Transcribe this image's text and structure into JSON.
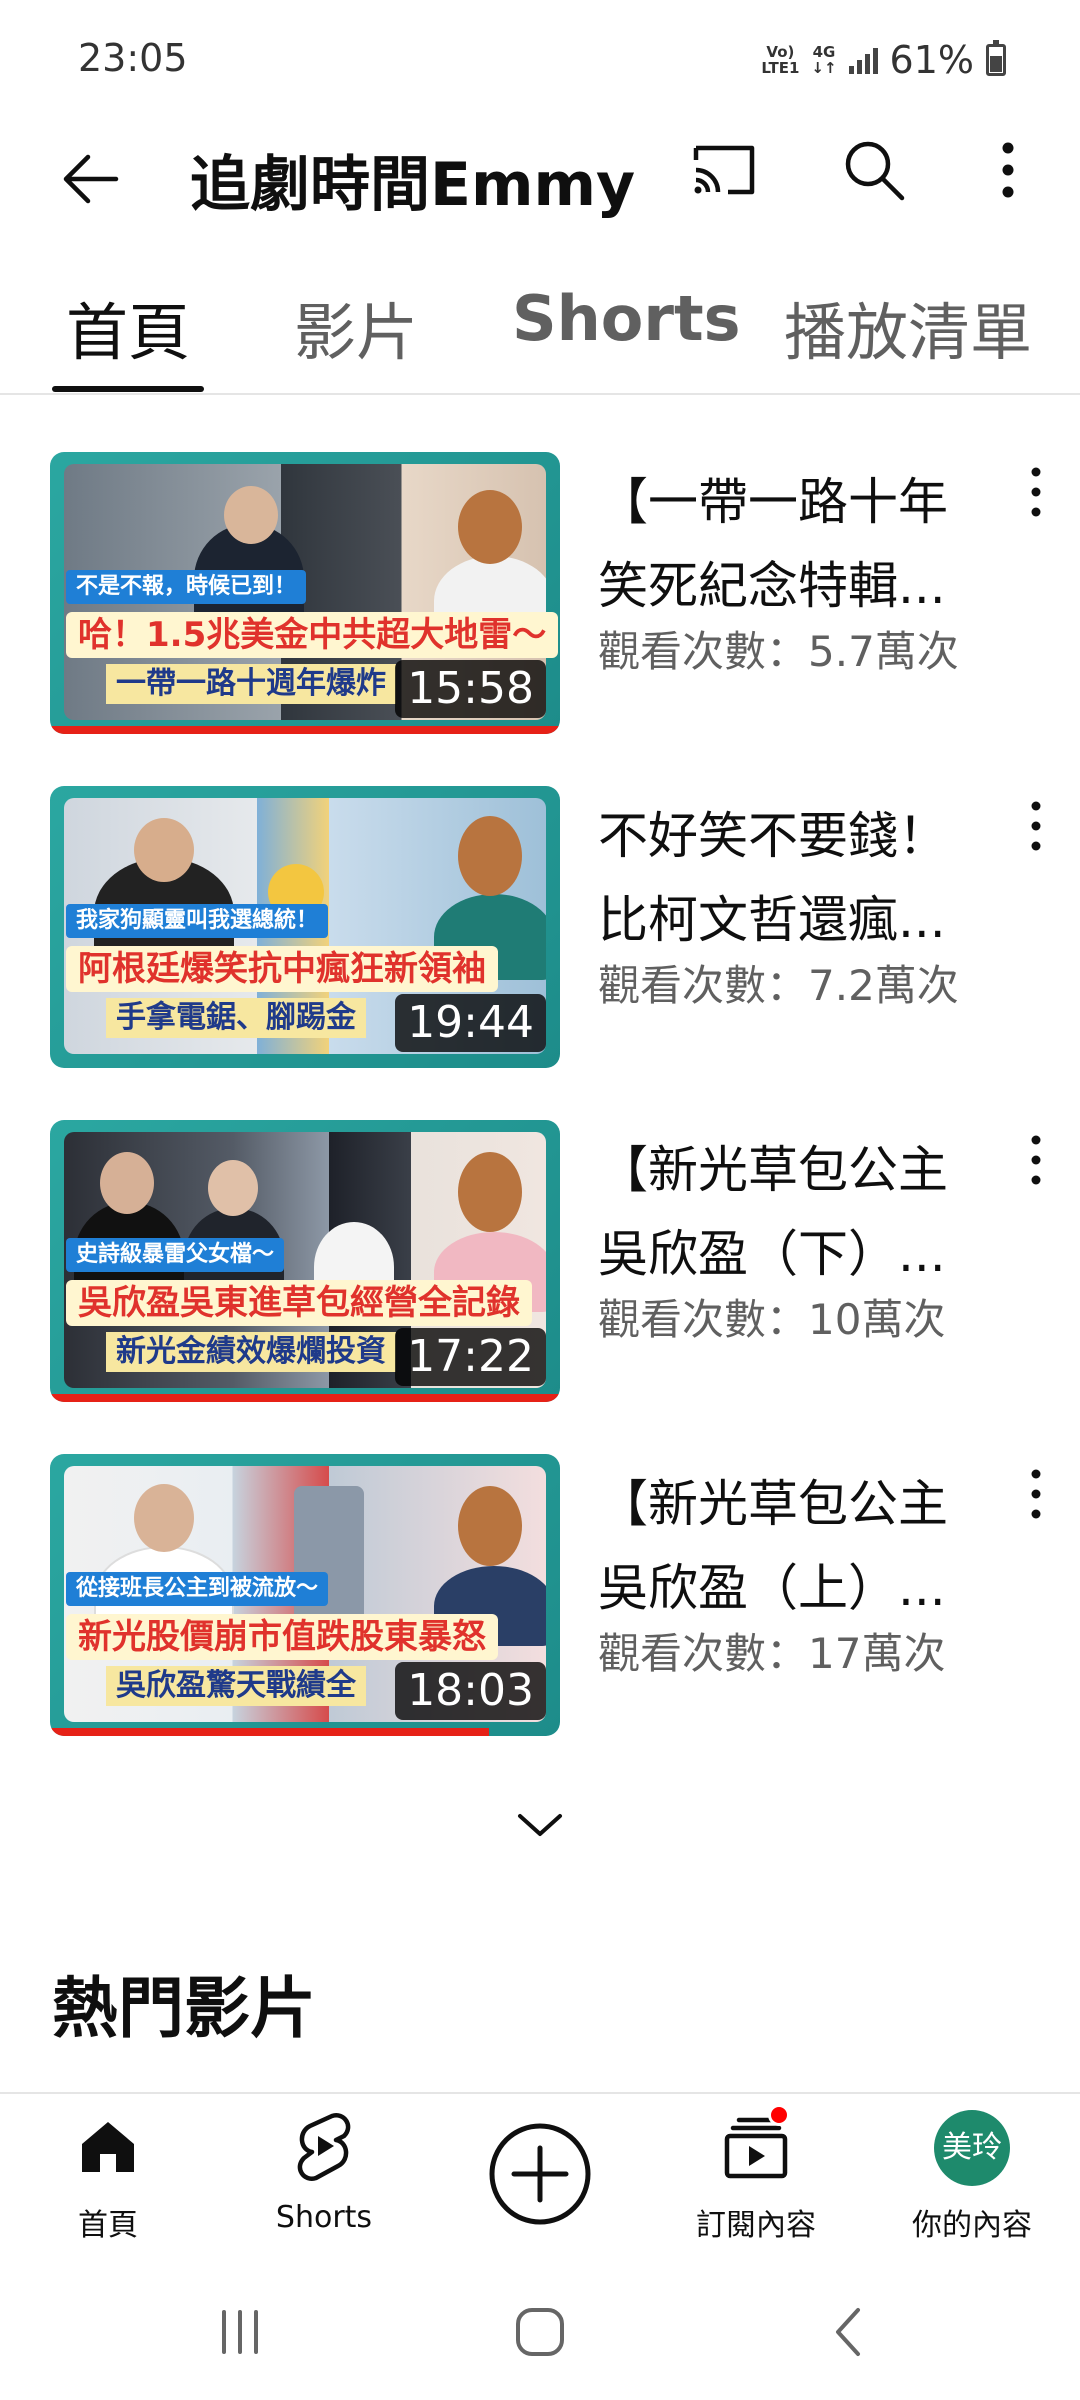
{
  "status_bar": {
    "time": "23:05",
    "net_top": "Vo)",
    "net_bottom": "LTE1",
    "net_type": "4G",
    "battery": "61%",
    "icons": [
      "volte-icon",
      "4g-icon",
      "signal-icon",
      "battery-icon"
    ]
  },
  "header": {
    "title": "追劇時間Emmy",
    "icons": [
      "back-arrow-icon",
      "cast-icon",
      "search-icon",
      "more-vert-icon"
    ]
  },
  "tabs": [
    {
      "label": "首頁",
      "active": true
    },
    {
      "label": "影片",
      "active": false
    },
    {
      "label": "Shorts",
      "active": false
    },
    {
      "label": "播放清單",
      "active": false
    }
  ],
  "videos": [
    {
      "title_line1": "【一帶一路十年",
      "title_line2": "笑死紀念特輯...",
      "views": "觀看次數：5.7萬次",
      "duration": "15:58",
      "thumb_tag": "不是不報，時候已到！",
      "thumb_line1": "哈！1.5兆美金中共超大地雷～",
      "thumb_line2": "一帶一路十週年爆炸",
      "progress": 1.0
    },
    {
      "title_line1": "不好笑不要錢！",
      "title_line2": "比柯文哲還瘋...",
      "views": "觀看次數：7.2萬次",
      "duration": "19:44",
      "thumb_tag": "我家狗顯靈叫我選總統！",
      "thumb_line1": "阿根廷爆笑抗中瘋狂新領袖",
      "thumb_line2": "手拿電鋸、腳踢金",
      "progress": 0.0
    },
    {
      "title_line1": "【新光草包公主",
      "title_line2": "吳欣盈（下）...",
      "views": "觀看次數：10萬次",
      "duration": "17:22",
      "thumb_tag": "史詩級暴雷父女檔～",
      "thumb_line1": "吳欣盈吳東進草包經營全記錄",
      "thumb_line2": "新光金績效爆爛投資",
      "progress": 1.0
    },
    {
      "title_line1": "【新光草包公主",
      "title_line2": "吳欣盈（上）...",
      "views": "觀看次數：17萬次",
      "duration": "18:03",
      "thumb_tag": "從接班長公主到被流放～",
      "thumb_line1": "新光股價崩市值跌股東暴怒",
      "thumb_line2": "吳欣盈驚天戰績全",
      "progress": 0.86
    }
  ],
  "expand_icon": "chevron-down-icon",
  "section_title": "熱門影片",
  "bottom_nav": [
    {
      "label": "首頁",
      "icon": "home-icon"
    },
    {
      "label": "Shorts",
      "icon": "shorts-icon"
    },
    {
      "label": "",
      "icon": "create-plus-icon"
    },
    {
      "label": "訂閱內容",
      "icon": "subscriptions-icon",
      "badge": true
    },
    {
      "label": "你的內容",
      "icon": "avatar",
      "avatar_text": "美玲"
    }
  ],
  "system_nav": [
    "recents-icon",
    "home-circle-icon",
    "back-chevron-icon"
  ],
  "colors": {
    "accent_red": "#e62117",
    "thumb_teal": "#2ba7a1",
    "avatar_green": "#1e8a6c",
    "text_primary": "#0f0f0f",
    "text_secondary": "#606060"
  }
}
